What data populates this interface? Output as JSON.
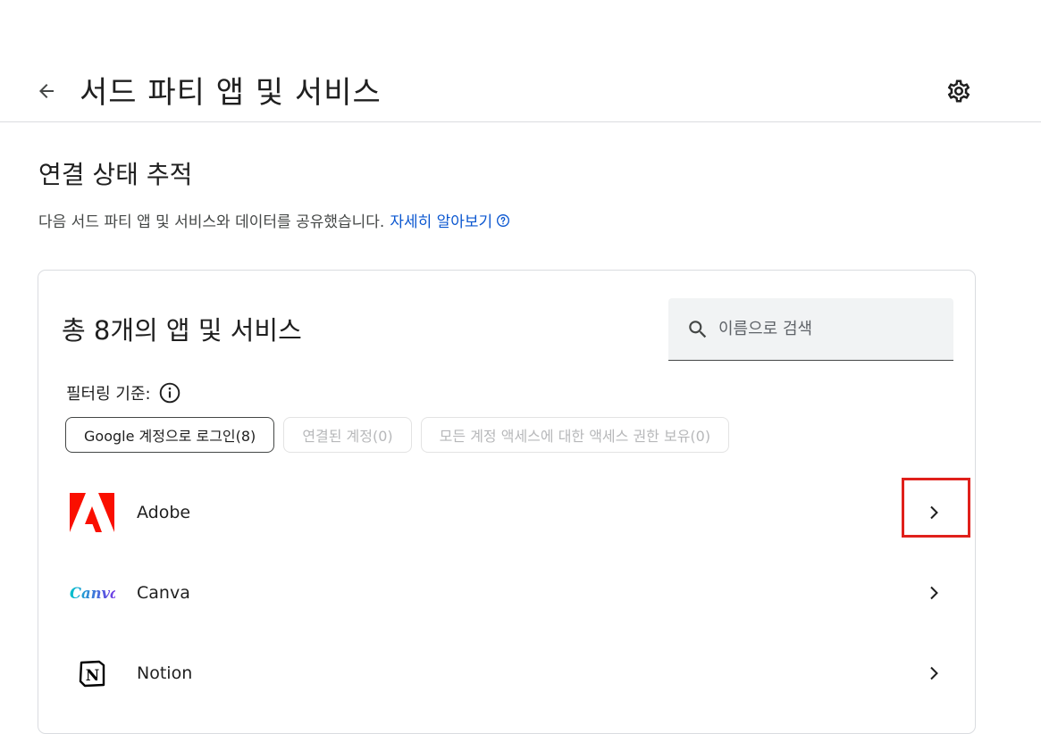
{
  "header": {
    "back_icon": "arrow-left-icon",
    "title": "서드 파티 앱 및 서비스",
    "settings_icon": "gear-icon"
  },
  "section": {
    "title": "연결 상태 추적",
    "description": "다음 서드 파티 앱 및 서비스와 데이터를 공유했습니다.",
    "learn_more": "자세히 알아보기",
    "help_icon": "help-circle-icon"
  },
  "card": {
    "title": "총 8개의 앱 및 서비스",
    "search": {
      "placeholder": "이름으로 검색",
      "icon": "search-icon"
    },
    "filter": {
      "label": "필터링 기준:",
      "info_icon": "info-icon",
      "chips": [
        {
          "label": "Google 계정으로 로그인(8)",
          "state": "active"
        },
        {
          "label": "연결된 계정(0)",
          "state": "disabled"
        },
        {
          "label": "모든 계정 액세스에 대한 액세스 권한 보유(0)",
          "state": "disabled"
        }
      ]
    },
    "apps": [
      {
        "name": "Adobe",
        "logo": "adobe-logo"
      },
      {
        "name": "Canva",
        "logo": "canva-logo",
        "logo_text": "Canva"
      },
      {
        "name": "Notion",
        "logo": "notion-logo",
        "logo_text": "N"
      }
    ]
  },
  "colors": {
    "link": "#0b57d0",
    "highlight_box": "#e0201b",
    "adobe_red": "#fa0f00",
    "canva_start": "#00c4cc",
    "canva_end": "#7d2ae8"
  }
}
